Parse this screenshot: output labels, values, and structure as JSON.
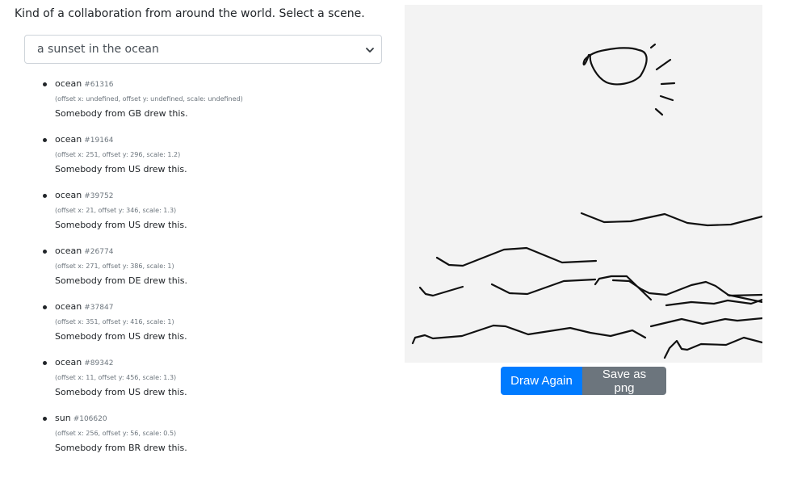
{
  "intro_text": "Kind of a collaboration from around the world. Select a scene.",
  "scene_select": {
    "selected": "a sunset in the ocean"
  },
  "drawings": [
    {
      "name": "ocean",
      "id": "#61316",
      "details": "(offset x: undefined, offset y: undefined, scale: undefined)",
      "credit": "Somebody from GB drew this."
    },
    {
      "name": "ocean",
      "id": "#19164",
      "details": "(offset x: 251, offset y: 296, scale: 1.2)",
      "credit": "Somebody from US drew this."
    },
    {
      "name": "ocean",
      "id": "#39752",
      "details": "(offset x: 21, offset y: 346, scale: 1.3)",
      "credit": "Somebody from US drew this."
    },
    {
      "name": "ocean",
      "id": "#26774",
      "details": "(offset x: 271, offset y: 386, scale: 1)",
      "credit": "Somebody from DE drew this."
    },
    {
      "name": "ocean",
      "id": "#37847",
      "details": "(offset x: 351, offset y: 416, scale: 1)",
      "credit": "Somebody from US drew this."
    },
    {
      "name": "ocean",
      "id": "#89342",
      "details": "(offset x: 11, offset y: 456, scale: 1.3)",
      "credit": "Somebody from US drew this."
    },
    {
      "name": "sun",
      "id": "#106620",
      "details": "(offset x: 256, offset y: 56, scale: 0.5)",
      "credit": "Somebody from BR drew this."
    }
  ],
  "buttons": {
    "draw_again": "Draw Again",
    "save_png": "Save as png"
  },
  "colors": {
    "primary": "#007bff",
    "secondary": "#6c757d",
    "canvas_bg": "#f3f3f3"
  }
}
